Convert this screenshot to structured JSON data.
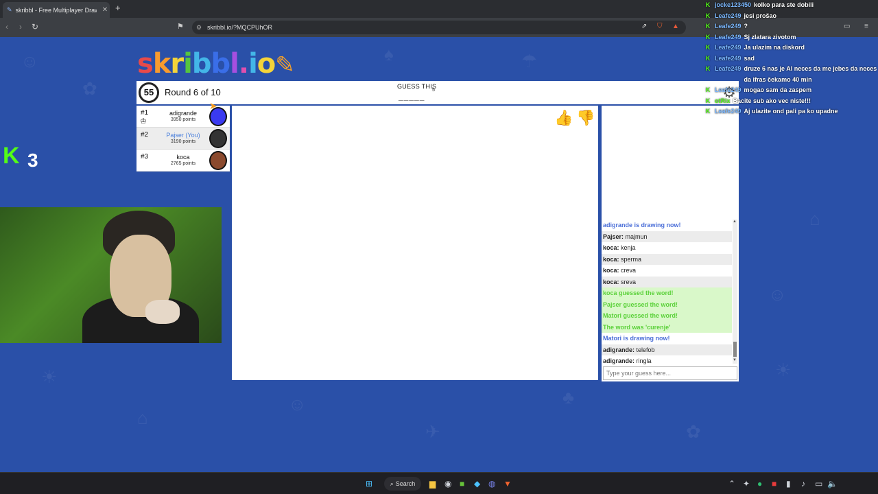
{
  "browser": {
    "tab_title": "skribbl - Free Multiplayer Drawing",
    "url": "skribbl.io/?MQCPUhOR"
  },
  "game": {
    "round_label": "Round 6 of 10",
    "timer": "55",
    "guess_label": "GUESS THIS",
    "letter_count": "5",
    "blanks": "_____"
  },
  "players": [
    {
      "rank": "#1",
      "name": "adigrande",
      "points": "3950 points",
      "you": false,
      "avatar_color": "#3a3af0"
    },
    {
      "rank": "#2",
      "name": "Pajser (You)",
      "points": "3190 points",
      "you": true,
      "avatar_color": "#222"
    },
    {
      "rank": "#3",
      "name": "koca",
      "points": "2765 points",
      "you": false,
      "avatar_color": "#8b4a2e"
    }
  ],
  "chat": {
    "messages": [
      {
        "type": "sys",
        "text": "adigrande is drawing now!"
      },
      {
        "type": "msg",
        "user": "Pajser:",
        "text": " majmun"
      },
      {
        "type": "msg",
        "user": "koca:",
        "text": " kenja"
      },
      {
        "type": "msg",
        "user": "koca:",
        "text": " sperma"
      },
      {
        "type": "msg",
        "user": "koca:",
        "text": " creva"
      },
      {
        "type": "msg",
        "user": "koca:",
        "text": " sreva"
      },
      {
        "type": "ok",
        "text": "koca guessed the word!"
      },
      {
        "type": "ok",
        "text": "Pajser guessed the word!"
      },
      {
        "type": "ok",
        "text": "Matori guessed the word!"
      },
      {
        "type": "ok",
        "text": "The word was 'curenje'"
      },
      {
        "type": "sys",
        "text": "Matori is drawing now!"
      },
      {
        "type": "msg",
        "user": "adigrande:",
        "text": " telefob"
      },
      {
        "type": "msg",
        "user": "adigrande:",
        "text": " ringla"
      }
    ],
    "input_placeholder": "Type your guess here..."
  },
  "stream": {
    "kick_count": "3",
    "chat": [
      {
        "user": "jocke123450",
        "text": "kolko para ste dobili",
        "green": false
      },
      {
        "user": "Leafe249",
        "text": "jesi prošao",
        "green": false
      },
      {
        "user": "Leafe249",
        "text": "?",
        "green": false
      },
      {
        "user": "Leafe249",
        "text": "Sj zlatara zivotom",
        "green": false
      },
      {
        "user": "Leafe249",
        "text": "Ja ulazim na diskord",
        "green": false
      },
      {
        "user": "Leafe249",
        "text": "sad",
        "green": false
      },
      {
        "user": "Leafe249",
        "text": "druze 6 nas je Al neces da me jebes da neces da ifras čekamo 40 min",
        "green": false
      },
      {
        "user": "Leafe249",
        "text": "mogao sam da zaspem",
        "green": false
      },
      {
        "user": "otRix",
        "text": "Bacite sub ako vec niste!!!",
        "green": true
      },
      {
        "user": "Leafe249",
        "text": "Aj ulazite ond pali pa ko upadne",
        "green": false
      }
    ]
  },
  "taskbar": {
    "search_label": "Search"
  }
}
